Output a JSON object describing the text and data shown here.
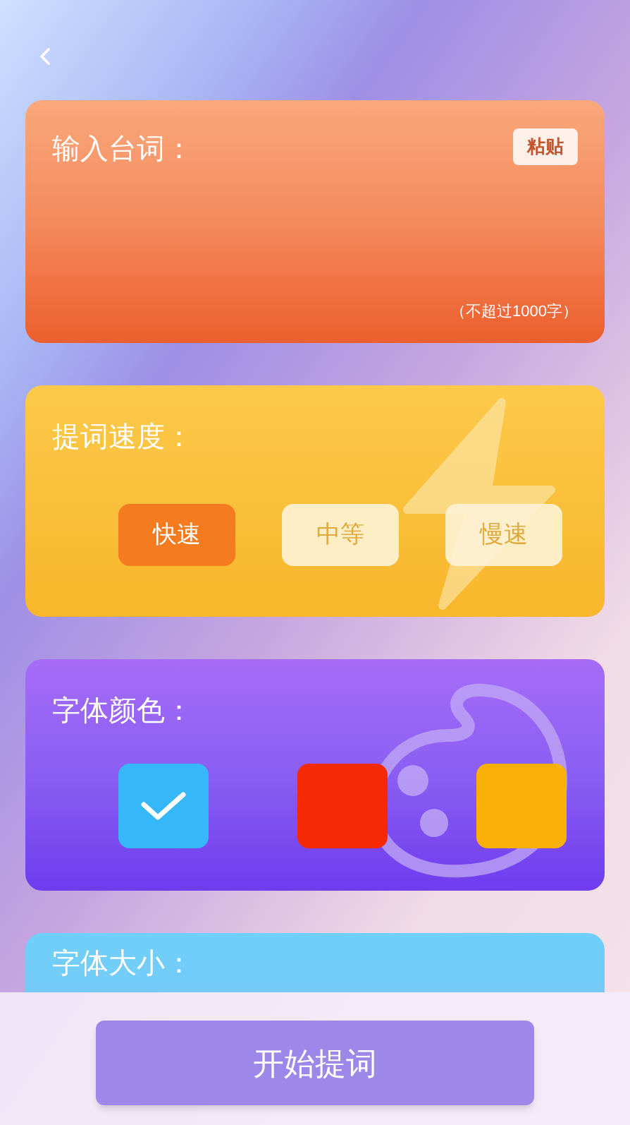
{
  "script_card": {
    "title": "输入台词：",
    "paste_button": "粘贴",
    "limit_hint": "（不超过1000字）"
  },
  "speed_card": {
    "title": "提词速度：",
    "options": [
      {
        "label": "快速",
        "selected": true
      },
      {
        "label": "中等",
        "selected": false
      },
      {
        "label": "慢速",
        "selected": false
      }
    ]
  },
  "color_card": {
    "title": "字体颜色：",
    "swatches": [
      {
        "color": "#35b7f9",
        "selected": true
      },
      {
        "color": "#f52a05",
        "selected": false
      },
      {
        "color": "#f9b10a",
        "selected": false
      }
    ]
  },
  "size_card": {
    "title": "字体大小："
  },
  "start_button": "开始提词"
}
